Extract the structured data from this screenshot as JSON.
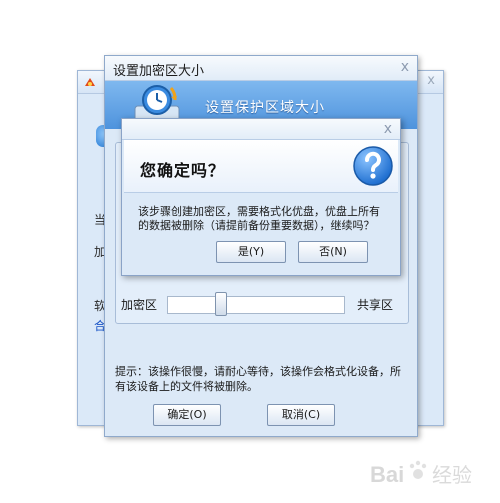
{
  "back_window": {
    "fragments": [
      "当",
      "加",
      "软",
      "合"
    ]
  },
  "main_window": {
    "title": "设置加密区大小",
    "close_glyph": "x",
    "header_title": "设置保护区域大小",
    "slider": {
      "left_label": "加密区",
      "right_label": "共享区"
    },
    "tip": "提示：该操作很慢，请耐心等待，该操作会格式化设备，所有该设备上的文件将被删除。",
    "ok_label": "确定(O)",
    "cancel_label": "取消(C)"
  },
  "confirm_dialog": {
    "close_glyph": "x",
    "question": "您确定吗？",
    "message": "该步骤创建加密区，需要格式化优盘，优盘上所有的数据被删除（请提前备份重要数据），继续吗？",
    "yes_label": "是(Y)",
    "no_label": "否(N)"
  },
  "watermark": {
    "text": "Bai 经验"
  },
  "colors": {
    "window_bg": "#dce9f7",
    "header_blue": "#4e93dd",
    "question_icon_blue": "#1f6fd0"
  }
}
